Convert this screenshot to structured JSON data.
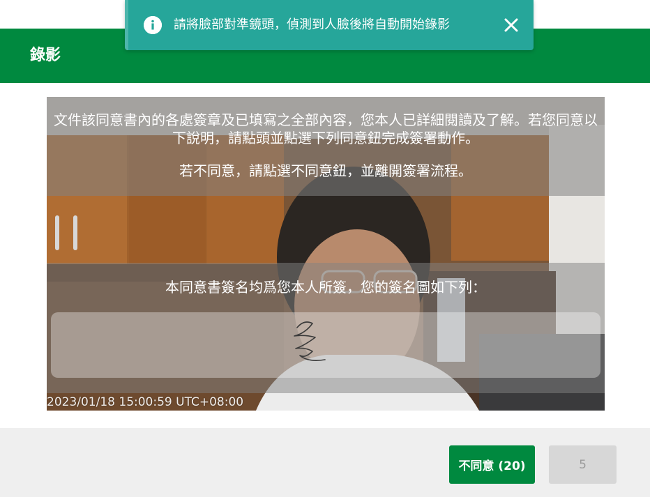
{
  "header": {
    "title": "錄影"
  },
  "toast": {
    "icon": "info-icon",
    "message": "請將臉部對準鏡頭，偵測到人臉後將自動開始錄影",
    "close_icon": "close-icon"
  },
  "camera": {
    "consent_text_1": "文件該同意書內的各處簽章及已填寫之全部內容，您本人已詳細閱讀及了解。若您同意以下說明，請點頭並點選下列同意鈕完成簽署動作。",
    "consent_text_2": "若不同意，請點選不同意鈕，並離開簽署流程。",
    "signature_text": "本同意書簽名均爲您本人所簽，您的簽名圖如下列：",
    "timestamp": "2023/01/18 15:00:59 UTC+08:00"
  },
  "footer": {
    "disagree_label": "不同意 (20)",
    "agree_label": "5"
  },
  "colors": {
    "brand_green": "#00893f",
    "toast_teal": "#26a69a",
    "footer_bg": "#efefef",
    "disabled_button": "#d7d7d7"
  }
}
